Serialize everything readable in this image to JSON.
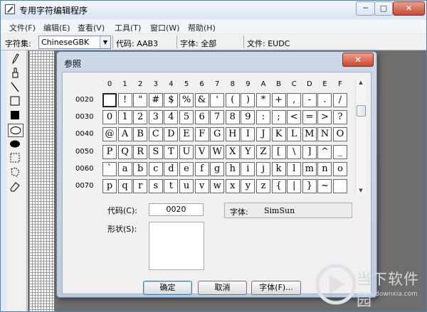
{
  "window": {
    "title": "专用字符编辑程序",
    "min": "─",
    "max": "□",
    "close": "✕"
  },
  "menu": [
    "文件(F)",
    "编辑(E)",
    "查看(V)",
    "工具(T)",
    "窗口(W)",
    "帮助(H)"
  ],
  "infobar": {
    "charset_label": "字符集:",
    "charset_value": "ChineseGBK",
    "code": "代码: AAB3",
    "font": "字体: 全部",
    "file": "文件: EUDC"
  },
  "tools": [
    "pencil-icon",
    "brush-icon",
    "line-icon",
    "hollow-rectangle-icon",
    "filled-rectangle-icon",
    "hollow-ellipse-icon",
    "filled-ellipse-icon",
    "rect-select-icon",
    "freeform-select-icon",
    "eraser-icon"
  ],
  "selected_tool": 5,
  "dialog": {
    "title": "参照",
    "close": "✕",
    "col_headers": [
      "0",
      "1",
      "2",
      "3",
      "4",
      "5",
      "6",
      "7",
      "8",
      "9",
      "A",
      "B",
      "C",
      "D",
      "E",
      "F"
    ],
    "rows": [
      {
        "code": "0020",
        "chars": [
          "",
          "!",
          "\"",
          "#",
          "$",
          "%",
          "&",
          "'",
          "(",
          ")",
          "*",
          "+",
          ",",
          "-",
          ".",
          "/"
        ]
      },
      {
        "code": "0030",
        "chars": [
          "0",
          "1",
          "2",
          "3",
          "4",
          "5",
          "6",
          "7",
          "8",
          "9",
          ":",
          ";",
          "<",
          "=",
          ">",
          "?"
        ]
      },
      {
        "code": "0040",
        "chars": [
          "@",
          "A",
          "B",
          "C",
          "D",
          "E",
          "F",
          "G",
          "H",
          "I",
          "J",
          "K",
          "L",
          "M",
          "N",
          "O"
        ]
      },
      {
        "code": "0050",
        "chars": [
          "P",
          "Q",
          "R",
          "S",
          "T",
          "U",
          "V",
          "W",
          "X",
          "Y",
          "Z",
          "[",
          "\\",
          "]",
          "^",
          "_"
        ]
      },
      {
        "code": "0060",
        "chars": [
          "`",
          "a",
          "b",
          "c",
          "d",
          "e",
          "f",
          "g",
          "h",
          "i",
          "j",
          "k",
          "l",
          "m",
          "n",
          "o"
        ]
      },
      {
        "code": "0070",
        "chars": [
          "p",
          "q",
          "r",
          "s",
          "t",
          "u",
          "v",
          "w",
          "x",
          "y",
          "z",
          "{",
          "|",
          "}",
          "~",
          ""
        ]
      }
    ],
    "code_label": "代码(C):",
    "code_value": "0020",
    "shape_label": "形状(S):",
    "font_label": "字体:",
    "font_value": "SimSun",
    "buttons": {
      "ok": "确定",
      "cancel": "取消",
      "font": "字体(F)..."
    }
  },
  "watermark": {
    "name": "当下软件园",
    "url": "www.downxia.com"
  }
}
